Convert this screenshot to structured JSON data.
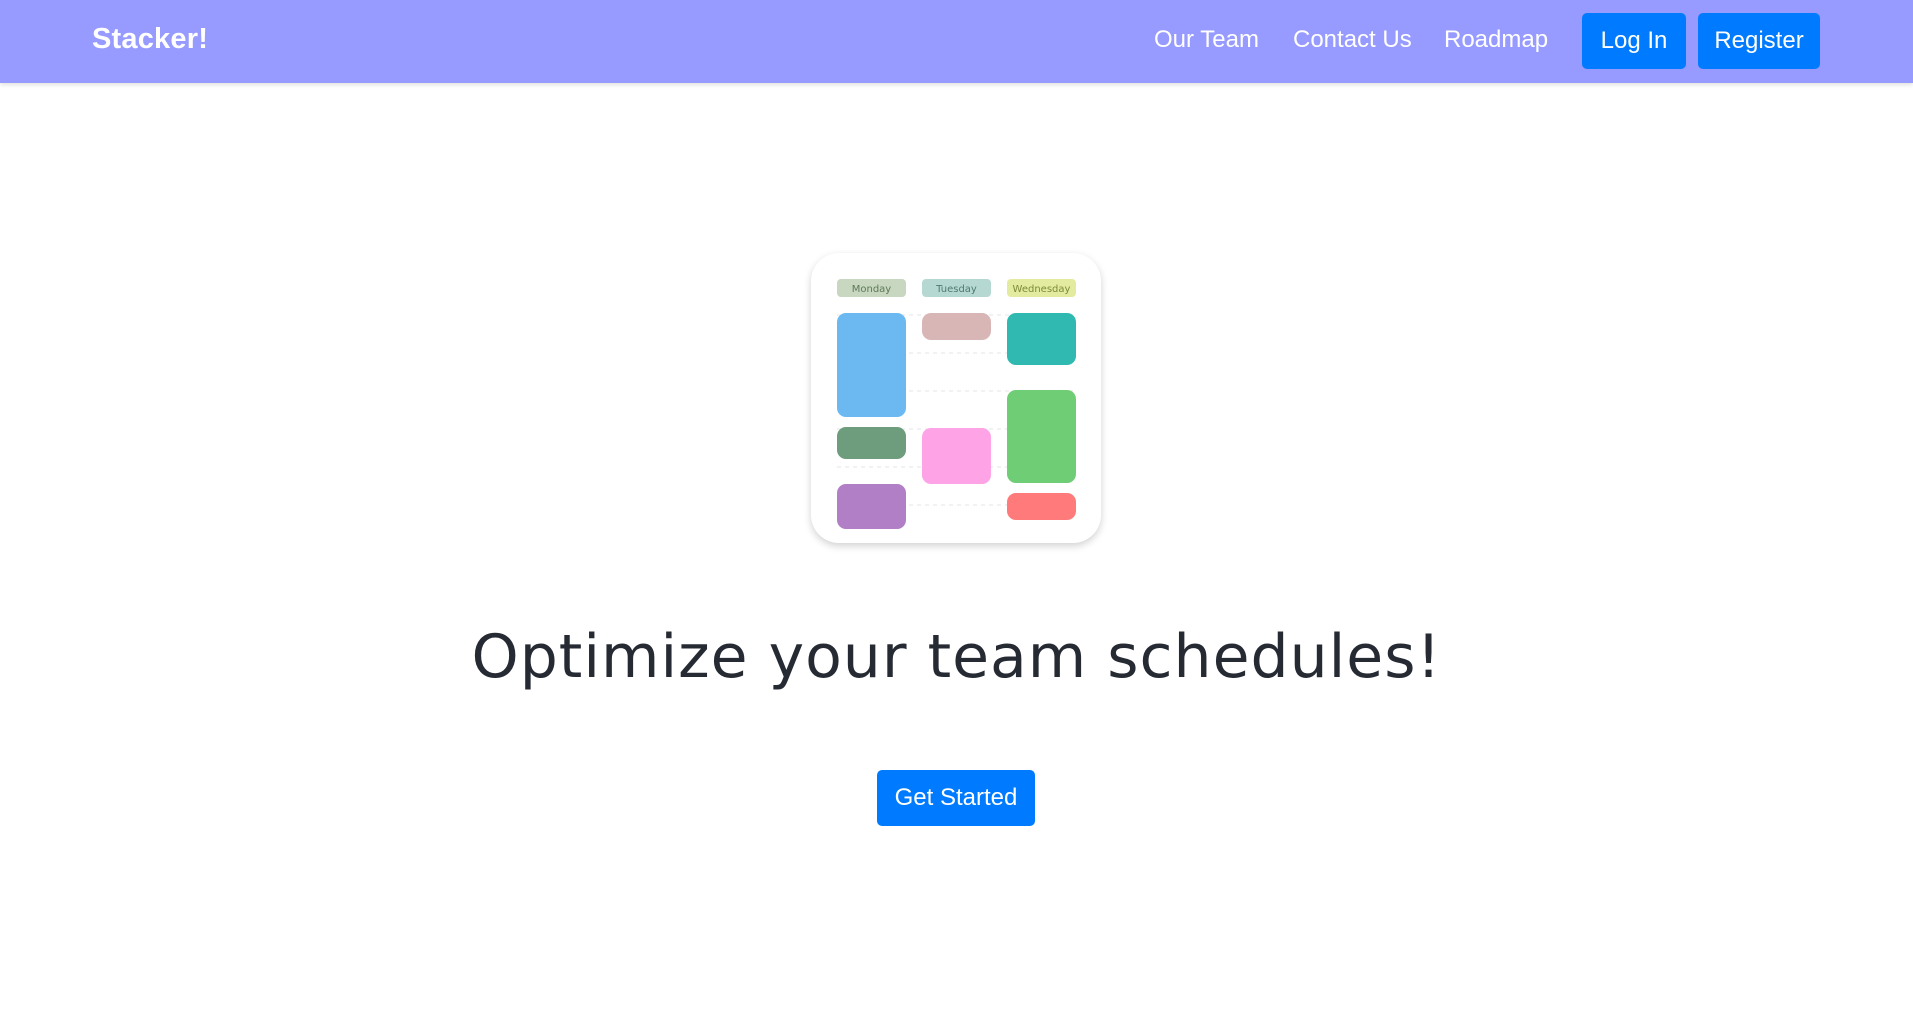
{
  "navbar": {
    "brand": "Stacker!",
    "links": [
      "Our Team",
      "Contact Us",
      "Roadmap"
    ],
    "login_label": "Log In",
    "register_label": "Register"
  },
  "hero": {
    "illustration": {
      "days": [
        "Monday",
        "Tuesday",
        "Wednesday"
      ],
      "colors": {
        "day_headers": [
          "#c7d7c0",
          "#b6d8d2",
          "#e2eb9f"
        ],
        "blocks": [
          "#6cb9f2",
          "#6d9d7c",
          "#b07fc6",
          "#d9b6b6",
          "#fda3e6",
          "#2fb9b1",
          "#6fcd76",
          "#ff7a7a"
        ]
      }
    },
    "headline": "Optimize your team schedules!",
    "cta_label": "Get Started"
  },
  "colors": {
    "navbar_bg": "#979bff",
    "primary": "#007bff",
    "text": "#262a33"
  }
}
